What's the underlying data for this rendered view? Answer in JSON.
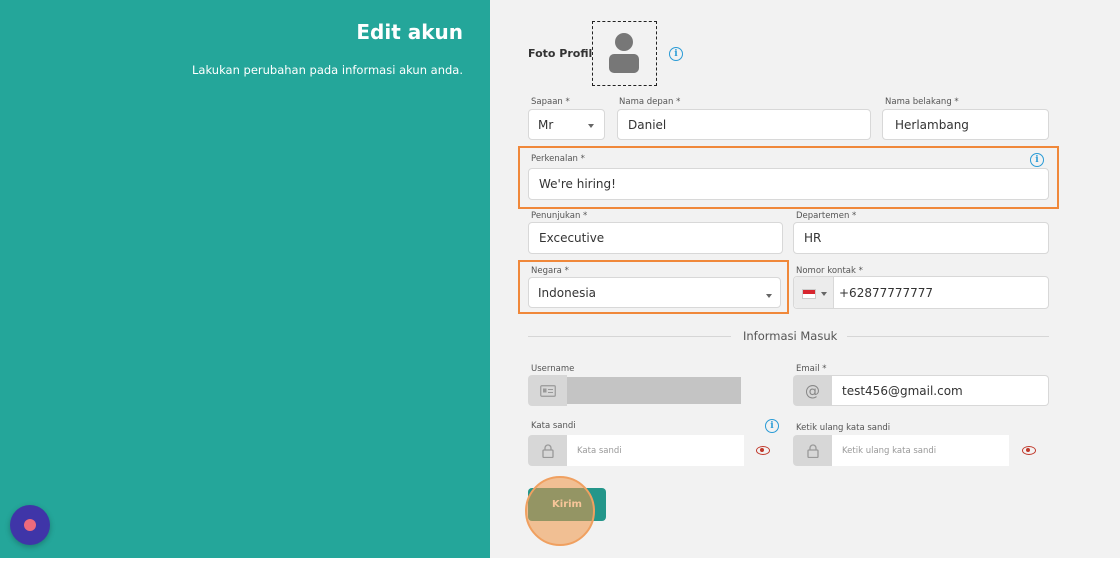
{
  "left": {
    "title": "Edit akun",
    "subtitle": "Lakukan perubahan pada informasi akun anda."
  },
  "profile": {
    "foto_label": "Foto Profil",
    "info_glyph": "i"
  },
  "fields": {
    "salutation": {
      "label": "Sapaan *",
      "value": "Mr"
    },
    "first_name": {
      "label": "Nama depan *",
      "value": "Daniel"
    },
    "last_name": {
      "label": "Nama belakang *",
      "value": "Herlambang"
    },
    "intro": {
      "label": "Perkenalan *",
      "value": "We're hiring!"
    },
    "designation": {
      "label": "Penunjukan *",
      "value": "Excecutive"
    },
    "department": {
      "label": "Departemen *",
      "value": "HR"
    },
    "country": {
      "label": "Negara *",
      "value": "Indonesia"
    },
    "phone": {
      "label": "Nomor kontak *",
      "value": "+62877777777",
      "flag": "indonesia-flag-icon"
    }
  },
  "login": {
    "section_title": "Informasi Masuk",
    "username": {
      "label": "Username",
      "value": ""
    },
    "email": {
      "label": "Email *",
      "value": "test456@gmail.com",
      "addon_glyph": "@"
    },
    "password": {
      "label": "Kata sandi",
      "placeholder": "Kata sandi"
    },
    "confirm_password": {
      "label": "Ketik ulang kata sandi",
      "placeholder": "Ketik ulang kata sandi"
    }
  },
  "submit_label": "Kirim",
  "colors": {
    "primary": "#24a69a",
    "highlight": "#f0883a",
    "info": "#2a9bd6",
    "eye": "#c0392b",
    "chat": "#3f35a8"
  }
}
